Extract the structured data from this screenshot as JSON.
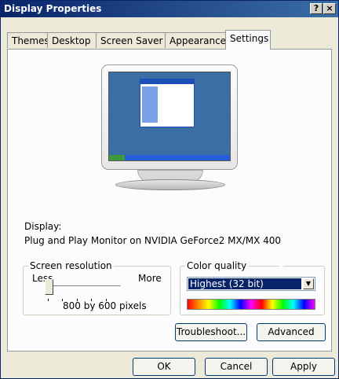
{
  "window": {
    "title": "Display Properties",
    "help_label": "?",
    "close_label": "×"
  },
  "tabs": [
    {
      "label": "Themes"
    },
    {
      "label": "Desktop"
    },
    {
      "label": "Screen Saver"
    },
    {
      "label": "Appearance"
    },
    {
      "label": "Settings"
    }
  ],
  "display": {
    "label": "Display:",
    "monitor_text": "Plug and Play Monitor on NVIDIA GeForce2 MX/MX 400"
  },
  "screen_resolution": {
    "legend": "Screen resolution",
    "less_label": "Less",
    "more_label": "More",
    "value_text": "800 by 600 pixels",
    "slider_position": 0
  },
  "color_quality": {
    "legend": "Color quality",
    "selected": "Highest (32 bit)"
  },
  "buttons": {
    "troubleshoot": "Troubleshoot...",
    "advanced": "Advanced",
    "ok": "OK",
    "cancel": "Cancel",
    "apply": "Apply"
  },
  "colors": {
    "title_bar": "#0a246a",
    "selection": "#0a246a"
  }
}
